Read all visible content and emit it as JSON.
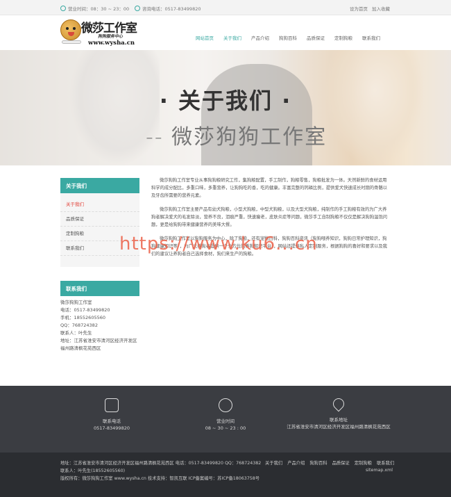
{
  "topbar": {
    "hours": "营业时间：08：30 ~ 23：00",
    "phone": "咨询电话：0517-83499820",
    "set_home": "设为首页",
    "add_favorite": "加入收藏"
  },
  "logo": {
    "brand": "微莎工作室",
    "slogan": "狗狗服务中心",
    "url": "www.wysha.cn"
  },
  "nav": [
    "网站首页",
    "关于我们",
    "产品介绍",
    "狗狗百科",
    "品质保证",
    "定制狗粮",
    "联系我们"
  ],
  "banner": {
    "title": "·  关于我们  ·",
    "subtitle": "-- 微莎狗狗工作室"
  },
  "sidebar": {
    "about_title": "关于我们",
    "about_items": [
      "关于我们",
      "品质保证",
      "定制狗粮",
      "联系我们"
    ],
    "contact_title": "联系我们",
    "contact_lines": [
      "微莎狗狗工作室",
      "电话：0517-83499820",
      "手机：18552605560",
      "QQ：768724382",
      "联系人：叶先生",
      "地址：江苏省淮安市清河区经济开发区",
      "福州路清枫花苑西区"
    ]
  },
  "content": {
    "p1": "微莎狗狗工作室专业从事狗狗粮研究工作，集狗粮配置，手工制作，狗粮零售，狗粮批发为一体。天然新鲜的食材运用科学的成分配比，多重口味，多重营养，让狗狗吃的香，吃的健康。丰富完整的钙磷比例，提供爱犬快速成长时期的骨骼以及牙齿所需要的营养元素。",
    "p2": "微莎狗狗工作室主要产品有幼犬狗粮，小型犬狗粮，中型犬狗粮，以及大型犬狗粮，纯制作的手工狗粮有效的为广大养狗者解决爱犬的毛发除淡，营养不良，泪痕严重，快速瘦老，皮肤炎症等问题，微莎手工自制狗粮不仅仅是解决狗狗温饱问题，更是给狗狗带来健康营养的美味大餐。",
    "p3": "微莎狗狗工作室以狗狗服务为中心，除了狗粮，还有宠物百科，狗狗百科资讯（狗狗喂养知识，狗狗日常护理知识，狗狗健康知识等），为广大养狗者提供一个全方位的养狗知识平台），网站还提供私人定制服务，根据狗狗的喜好和要求以及我们的建议让养狗者自己选择食材，狗们来生产的狗粮。"
  },
  "watermark": "https://www.ku6...cn",
  "footer": {
    "phone_label": "联系电话",
    "phone_value": "0517-83499820",
    "hours_label": "营业时间",
    "hours_value": "08 ~ 30 ~ 23 : 00",
    "address_label": "联系地址",
    "address_value": "江苏省淮安市清河区经济开发区福州路清枫花苑西区",
    "info_line1": "地址：江苏省淮安市清河区经济开发区福州路清枫花苑西区  电话：0517-83499820  QQ：768724382 联系人：叶先生(18552605560)",
    "info_line2": "版权所有：微莎狗狗工作室 www.wysha.cn  技术支持：智凯互联  ICP备案编号：苏ICP备18063758号",
    "links": [
      "关于我们",
      "产品介绍",
      "狗狗百科",
      "品质保证",
      "定制狗粮",
      "联系我们"
    ],
    "sitemap": "sitemap.xml"
  },
  "colors": {
    "accent": "#3aa9a2",
    "active_red": "#e2453c",
    "footer_dark": "#3b3d42"
  }
}
